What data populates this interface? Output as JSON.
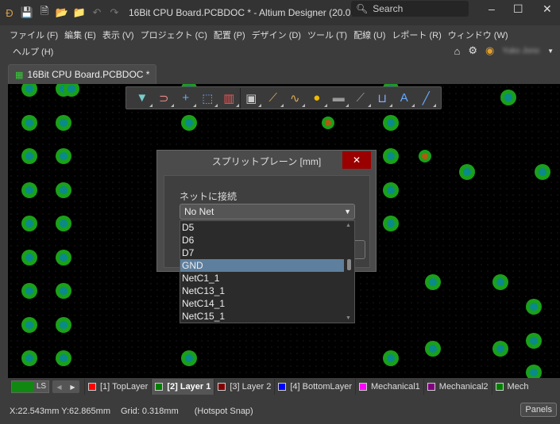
{
  "titlebar": {
    "title": "16Bit CPU Board.PCBDOC * - Altium Designer (20.0...",
    "search_placeholder": "Search"
  },
  "menu": [
    "ファイル (F)",
    "編集 (E)",
    "表示 (V)",
    "プロジェクト (C)",
    "配置 (P)",
    "デザイン (D)",
    "ツール (T)",
    "配線 (U)",
    "レポート (R)",
    "ウィンドウ (W)"
  ],
  "help": "ヘルプ (H)",
  "user": "Yuko Jono",
  "doc_tab": "16Bit CPU Board.PCBDOC *",
  "toolbar": [
    "filter-icon",
    "interactive-snap-icon",
    "cross-icon",
    "select-rect-icon",
    "align-icon",
    "component-icon",
    "route-icon",
    "length-tune-icon",
    "pad-icon",
    "polygon-icon",
    "keepout-icon",
    "dimension-icon",
    "text-icon",
    "line-icon"
  ],
  "dialog": {
    "title": "スプリットプレーン [mm]",
    "net_label": "ネットに接続",
    "selected": "No Net",
    "options": [
      "D5",
      "D6",
      "D7",
      "GND",
      "NetC1_1",
      "NetC13_1",
      "NetC14_1",
      "NetC15_1"
    ],
    "highlighted": "GND"
  },
  "layers": {
    "ls": "LS",
    "tabs": [
      {
        "label": "[1] TopLayer",
        "color": "#ff0000"
      },
      {
        "label": "[2] Layer 1",
        "color": "#008000",
        "active": true
      },
      {
        "label": "[3] Layer 2",
        "color": "#800000"
      },
      {
        "label": "[4] BottomLayer",
        "color": "#0000ff"
      },
      {
        "label": "Mechanical1",
        "color": "#ff00ff"
      },
      {
        "label": "Mechanical2",
        "color": "#800080"
      },
      {
        "label": "Mech",
        "color": "#008000"
      }
    ]
  },
  "status": {
    "coords": "X:22.543mm Y:62.865mm",
    "grid": "Grid: 0.318mm",
    "snap": "(Hotspot Snap)",
    "panels": "Panels"
  }
}
